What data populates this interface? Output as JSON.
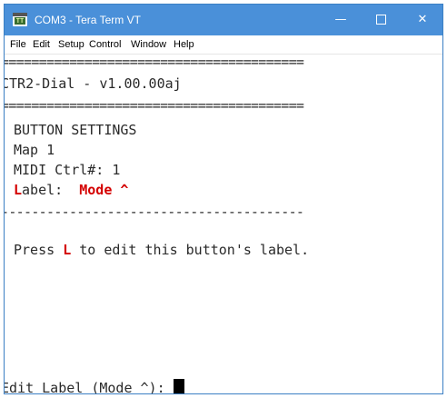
{
  "window": {
    "title": "COM3 - Tera Term VT",
    "icon": "teraterm-app-icon",
    "controls": {
      "minimize": "—",
      "close": "✕"
    }
  },
  "menu": [
    "File",
    "Edit",
    "Setup",
    "Control",
    "Window",
    "Help"
  ],
  "terminal": {
    "rule_double": "========================================",
    "header": "CTR2-Dial - v1.00.00aj",
    "section_title": "BUTTON SETTINGS",
    "map_line": "Map 1",
    "midi_line": "MIDI Ctrl#: 1",
    "label_key": "L",
    "label_rest": "abel:",
    "label_value": "Mode ^",
    "rule_single": "----------------------------------------",
    "press_prefix": "Press",
    "press_key": "L",
    "press_suffix": "to edit this button's label.",
    "prompt": "Edit Label (Mode ^):"
  },
  "colors": {
    "titlebar": "#4a90d9",
    "highlight_red": "#d40000"
  }
}
